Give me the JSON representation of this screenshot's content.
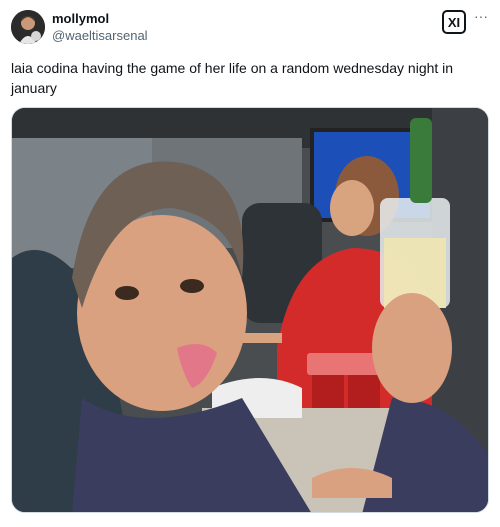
{
  "tweet": {
    "display_name": "mollymol",
    "handle": "@waeltisarsenal",
    "badge_label": "XI",
    "more_label": "···",
    "text": "laia codina having the game of her life on a random wednesday night in january"
  },
  "colors": {
    "text_primary": "#0f1419",
    "text_secondary": "#536471",
    "border": "#cfd9de",
    "jersey_red": "#d32a2a",
    "can_red": "#b21e1e"
  },
  "icons": {
    "avatar": "profile-photo",
    "badge": "xi-badge-icon",
    "more": "more-dots-icon"
  }
}
